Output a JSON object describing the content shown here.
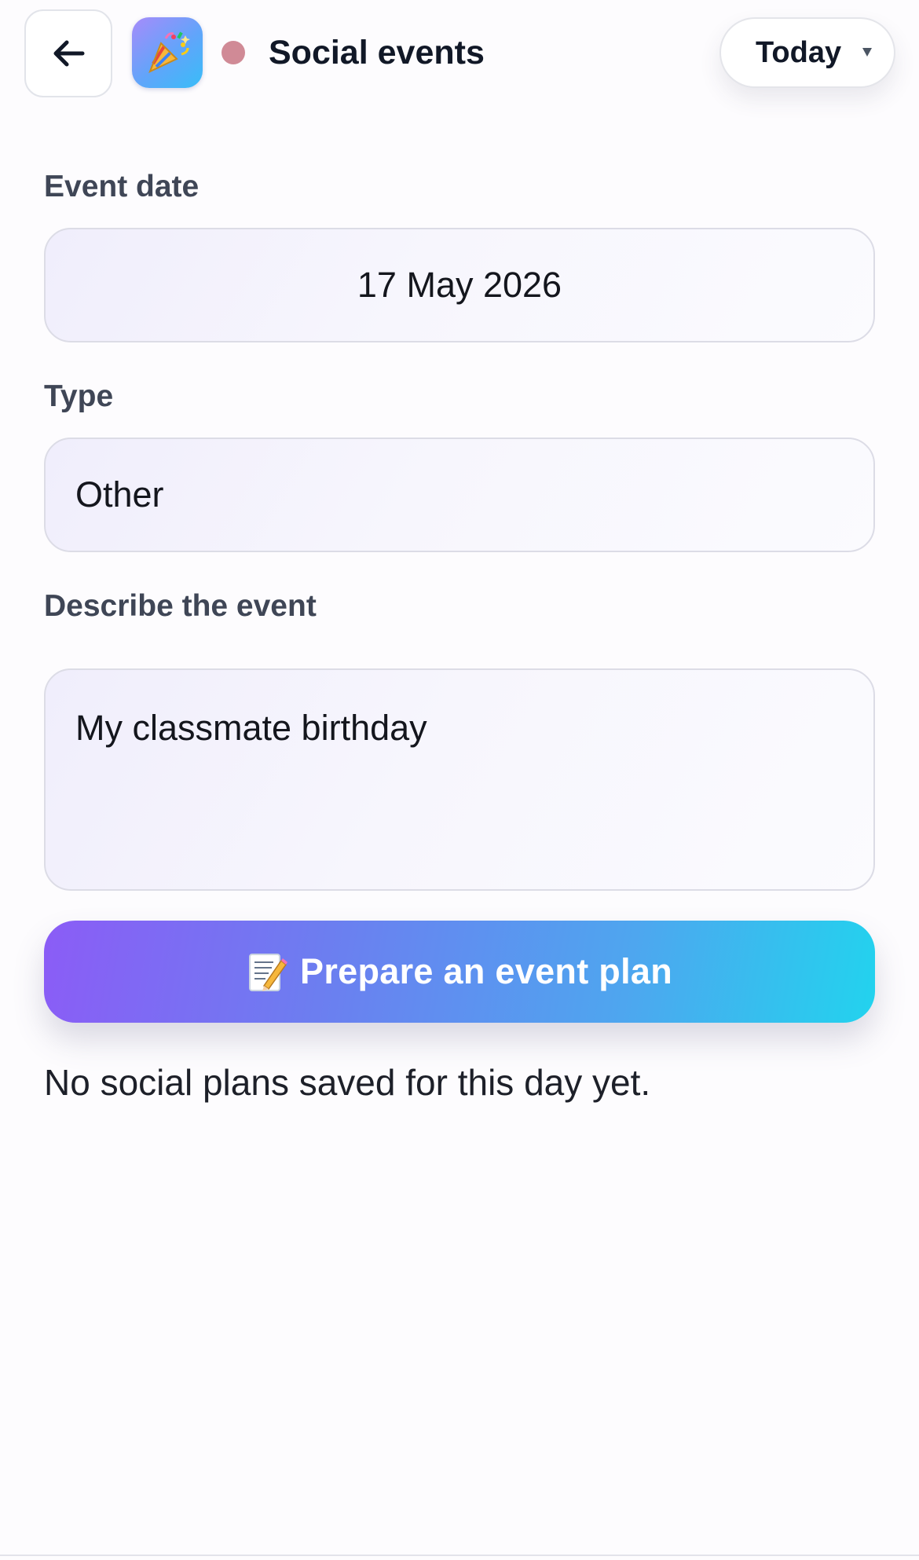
{
  "header": {
    "title": "Social events",
    "back_icon": "arrow-left-icon",
    "app_icon": "party-popper-icon",
    "status_dot_color": "#d08a96",
    "date_filter": {
      "selected": "Today",
      "icon": "chevron-down-icon"
    }
  },
  "form": {
    "event_date": {
      "label": "Event date",
      "value": "17 May 2026"
    },
    "type": {
      "label": "Type",
      "value": "Other"
    },
    "description": {
      "label": "Describe the event",
      "value": "My classmate birthday"
    },
    "submit": {
      "label": "Prepare an event plan",
      "icon": "memo-icon"
    }
  },
  "empty_state": {
    "text": "No social plans saved for this day yet."
  },
  "colors": {
    "button_gradient_start": "#8b5cf6",
    "button_gradient_end": "#22d3ee",
    "label_color": "#3f4656"
  }
}
